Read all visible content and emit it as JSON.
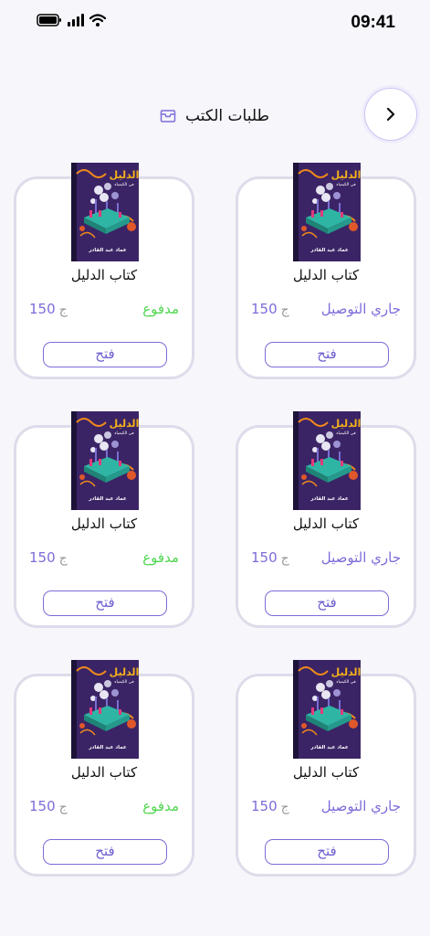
{
  "status_bar": {
    "time": "09:41"
  },
  "header": {
    "title": "طلبات الكتب"
  },
  "currency": "ج",
  "orders": [
    {
      "title": "كتاب الدليل",
      "status": "جاري التوصيل",
      "status_type": "delivering",
      "price": "150",
      "button": "فتح"
    },
    {
      "title": "كتاب الدليل",
      "status": "مدفوع",
      "status_type": "paid",
      "price": "150",
      "button": "فتح"
    },
    {
      "title": "كتاب الدليل",
      "status": "جاري التوصيل",
      "status_type": "delivering",
      "price": "150",
      "button": "فتح"
    },
    {
      "title": "كتاب الدليل",
      "status": "مدفوع",
      "status_type": "paid",
      "price": "150",
      "button": "فتح"
    },
    {
      "title": "كتاب الدليل",
      "status": "جاري التوصيل",
      "status_type": "delivering",
      "price": "150",
      "button": "فتح"
    },
    {
      "title": "كتاب الدليل",
      "status": "مدفوع",
      "status_type": "paid",
      "price": "150",
      "button": "فتح"
    }
  ],
  "cover": {
    "main_title": "الدليل",
    "subtitle": "في الكيمياء",
    "author": "عماد عبد القادر"
  },
  "colors": {
    "accent": "#7b6cd9",
    "paid": "#4fd64f",
    "cover_bg": "#3b2466",
    "cover_title": "#f5b21a"
  },
  "icons": {
    "back": "chevron-right-icon",
    "orders": "inbox-icon"
  }
}
